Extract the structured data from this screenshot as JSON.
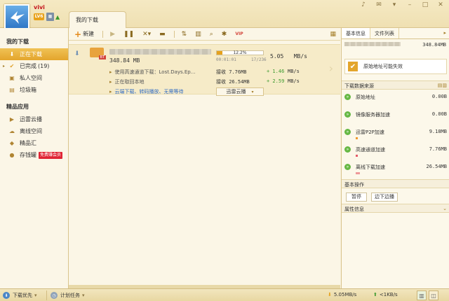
{
  "user": {
    "name": "vivi",
    "level": "LV6"
  },
  "main_tab": "我的下载",
  "sidebar": {
    "section1": "我的下载",
    "items1": [
      {
        "label": "正在下载",
        "active": true,
        "icon": "download-icon"
      },
      {
        "label": "已完成",
        "count": "(19)",
        "icon": "check-icon"
      },
      {
        "label": "私人空间",
        "icon": "lock-icon"
      },
      {
        "label": "垃圾箱",
        "icon": "trash-icon"
      }
    ],
    "section2": "精品应用",
    "items2": [
      {
        "label": "迅雷云播",
        "icon": "cloud-play-icon"
      },
      {
        "label": "离线空间",
        "icon": "offline-icon"
      },
      {
        "label": "精品汇",
        "icon": "apps-icon"
      },
      {
        "label": "存钱罐",
        "tag": "免费赚会员",
        "icon": "piggy-bank-icon"
      }
    ]
  },
  "toolbar": {
    "new_label": "新建"
  },
  "task": {
    "size": "348.84 MB",
    "progress_text": "12.2%",
    "progress": 0.122,
    "elapsed": "00:01:01",
    "pieces": "17/236",
    "speed": "5.05",
    "speed_unit": "MB/s",
    "line1": "使用高速通道下载：Lost.Days.Ep...",
    "line2": "正在取回本地",
    "line3": "云端下载、转码播放、无需等待",
    "recv1_label": "接收 7.76MB",
    "recv1_add": "+ 1.46",
    "recv2_label": "接收 26.54MB",
    "recv2_add": "+ 2.59",
    "unit": "MB/s",
    "cloud_button": "迅雷云播"
  },
  "right": {
    "tabs": [
      "基本信息",
      "文件列表"
    ],
    "size": "348.84MB",
    "alert": "原始地址可能失效",
    "sources_title": "下载数据来源",
    "sources": [
      {
        "name": "原始地址",
        "value": "0.00B",
        "bar": 0
      },
      {
        "name": "镜像服务器加速",
        "value": "0.00B",
        "bar": 0
      },
      {
        "name": "迅雷P2P加速",
        "value": "9.18MB",
        "bar": 0.02
      },
      {
        "name": "高速通道加速",
        "value": "7.76MB",
        "bar": 0.02
      },
      {
        "name": "离线下载加速",
        "value": "26.54MB",
        "bar": 0.05
      }
    ],
    "ops_title": "基本操作",
    "op_pause": "暂停",
    "op_play": "边下边播",
    "attr_title": "属性信息"
  },
  "status": {
    "priority": "下载优先",
    "plan": "计划任务",
    "down_speed": "5.05MB/s",
    "up_speed": "<1KB/s"
  }
}
